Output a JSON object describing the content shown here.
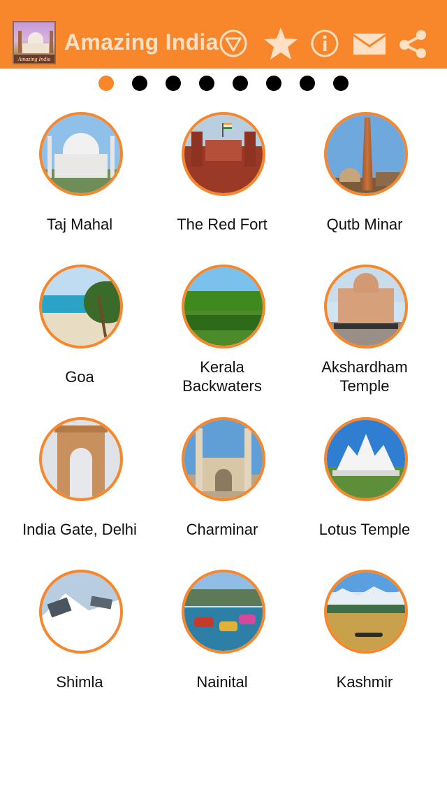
{
  "header": {
    "title": "Amazing India",
    "logo_text": "Amazing India",
    "icons": [
      "filter-icon",
      "star-icon",
      "info-icon",
      "mail-icon",
      "share-icon"
    ]
  },
  "pager": {
    "total": 8,
    "active_index": 0
  },
  "places": [
    {
      "label": "Taj Mahal",
      "icon": "taj-mahal-thumbnail"
    },
    {
      "label": "The Red Fort",
      "icon": "red-fort-thumbnail"
    },
    {
      "label": "Qutb Minar",
      "icon": "qutb-minar-thumbnail"
    },
    {
      "label": "Goa",
      "icon": "goa-thumbnail"
    },
    {
      "label": "Kerala Backwaters",
      "line1": "Kerala",
      "line2": "Backwaters",
      "icon": "kerala-thumbnail"
    },
    {
      "label": "Akshardham Temple",
      "line1": "Akshardham",
      "line2": "Temple",
      "icon": "akshardham-thumbnail"
    },
    {
      "label": "India Gate, Delhi",
      "icon": "india-gate-thumbnail"
    },
    {
      "label": "Charminar",
      "icon": "charminar-thumbnail"
    },
    {
      "label": "Lotus Temple",
      "icon": "lotus-temple-thumbnail"
    },
    {
      "label": "Shimla",
      "icon": "shimla-thumbnail"
    },
    {
      "label": "Nainital",
      "icon": "nainital-thumbnail"
    },
    {
      "label": "Kashmir",
      "icon": "kashmir-thumbnail"
    }
  ],
  "colors": {
    "accent": "#f7872a",
    "title": "#ffe0c5",
    "dot": "#000000"
  }
}
